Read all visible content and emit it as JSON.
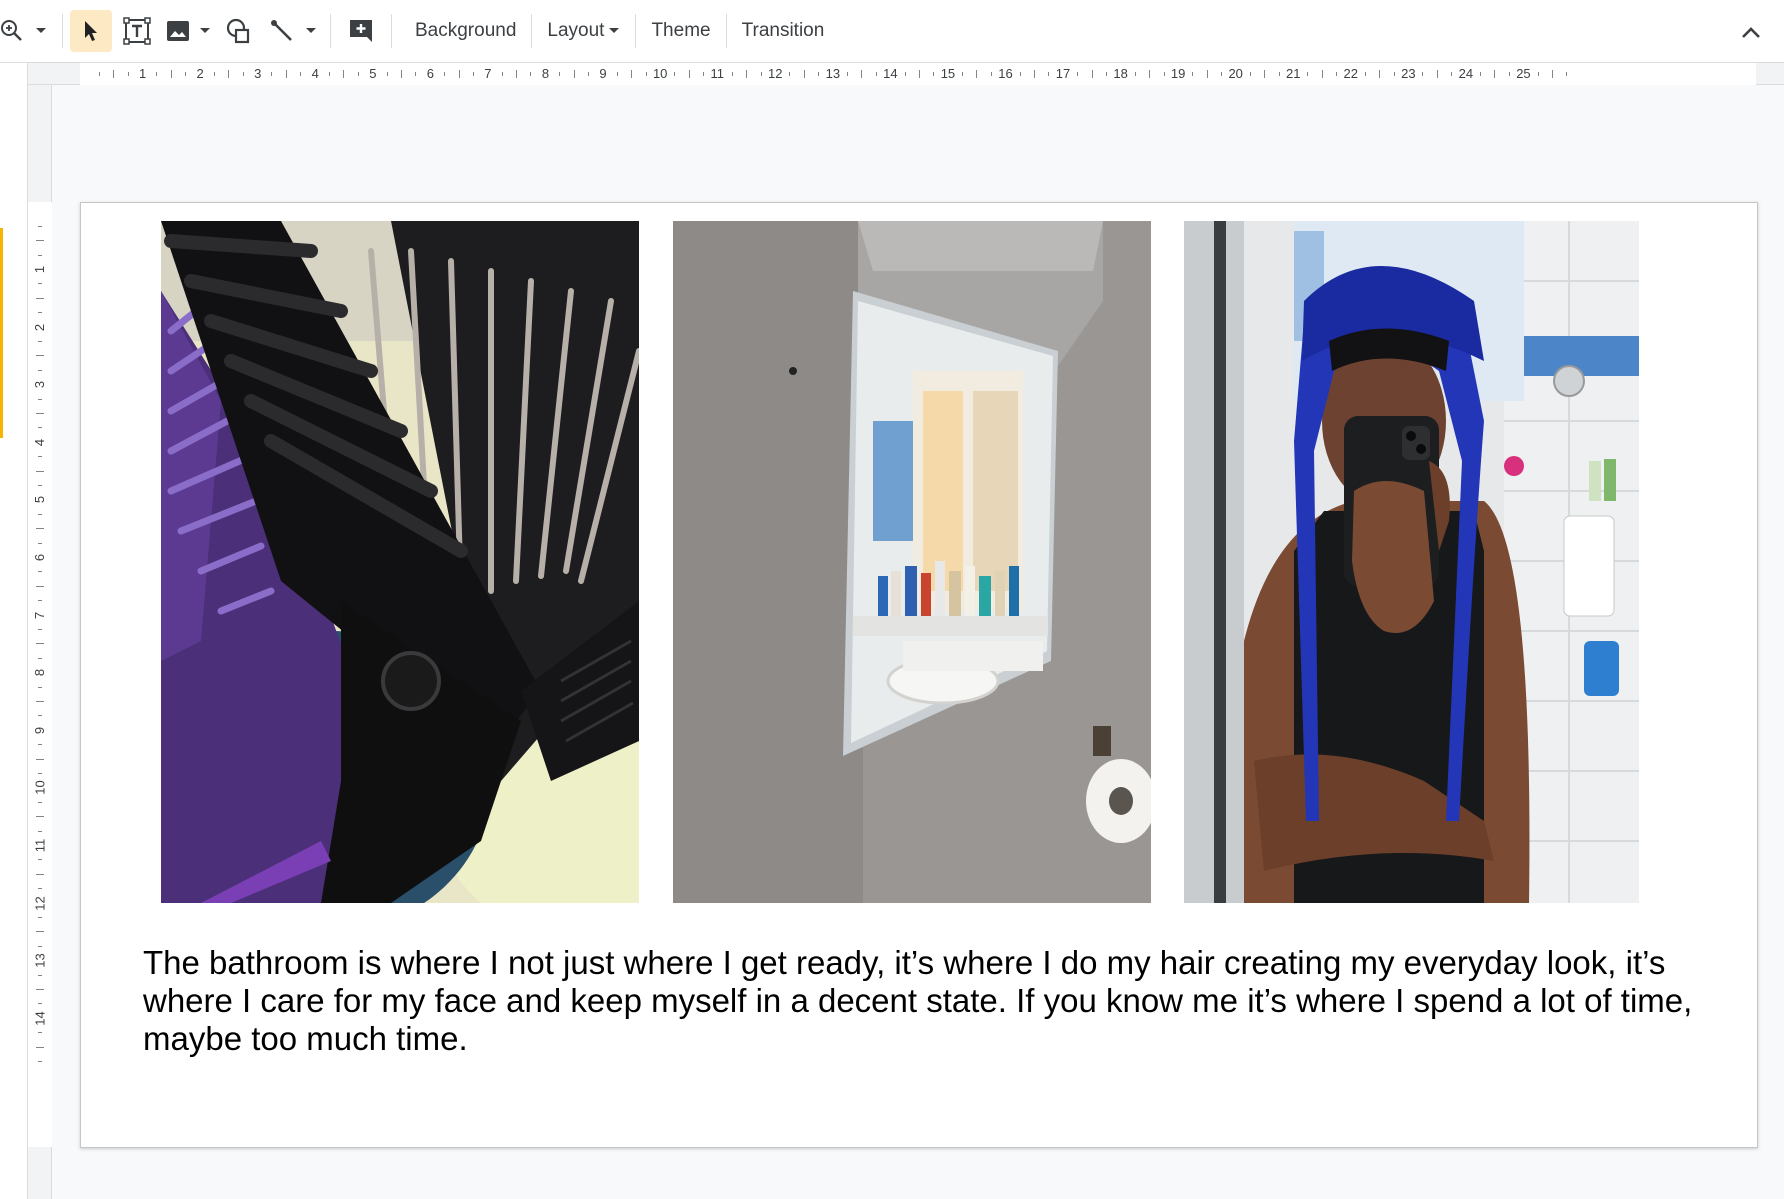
{
  "toolbar": {
    "icons": [
      "zoom-icon",
      "chevron-down-icon",
      "select-cursor-icon",
      "text-box-icon",
      "image-icon",
      "shape-icon",
      "line-icon",
      "new-comment-icon",
      "chevron-up-icon"
    ],
    "background_label": "Background",
    "layout_label": "Layout",
    "theme_label": "Theme",
    "transition_label": "Transition",
    "active_tool": "select"
  },
  "rulers": {
    "horizontal": [
      "1",
      "2",
      "3",
      "4",
      "5",
      "6",
      "7",
      "8",
      "9",
      "10",
      "11",
      "12",
      "13",
      "14",
      "15",
      "16",
      "17",
      "18",
      "19",
      "20",
      "21",
      "22",
      "23",
      "24",
      "25"
    ],
    "vertical": [
      "1",
      "2",
      "3",
      "4",
      "5",
      "6",
      "7",
      "8",
      "9",
      "10",
      "11",
      "12",
      "13",
      "14"
    ]
  },
  "slide": {
    "photos": [
      {
        "name": "photo-combs",
        "subject": "black and purple hair combs"
      },
      {
        "name": "photo-bathroom-mirror",
        "subject": "bathroom mirror cabinet and toilet roll"
      },
      {
        "name": "photo-mirror-selfie",
        "subject": "mirror selfie wearing blue durag"
      }
    ],
    "caption": "The bathroom is where I not just where I get ready, it’s where I do my hair creating my everyday look, it’s where I care for my face and keep myself in a decent state. If you know me it’s where I spend a lot of time, maybe too much time."
  },
  "colors": {
    "accent": "#f4b400",
    "active_tool_bg": "#fde9c4",
    "toolbar_text": "#3c4043",
    "canvas_bg": "#f8f9fa"
  }
}
